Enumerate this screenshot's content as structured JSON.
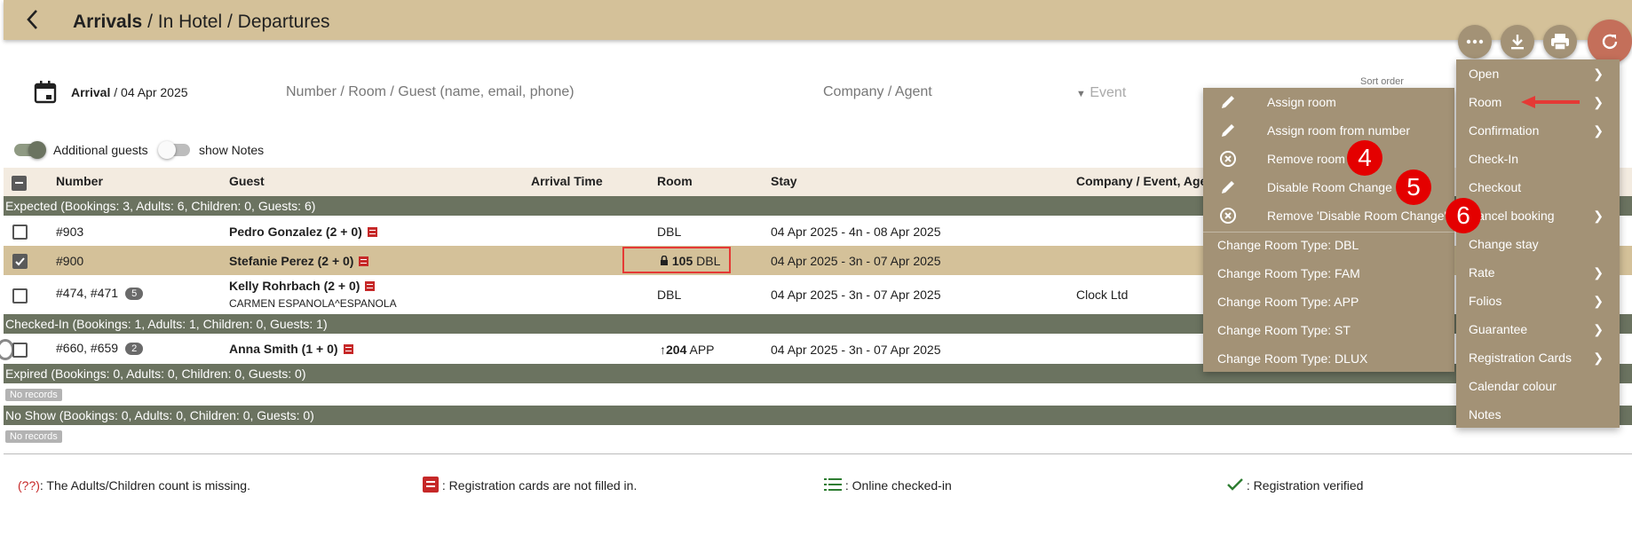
{
  "header": {
    "back_icon": "chevron-left-icon",
    "crumbs": [
      "Arrivals",
      "In Hotel",
      "Departures"
    ],
    "separator": "/"
  },
  "toolbar": {
    "more_icon": "more-horizontal-icon",
    "download_icon": "download-icon",
    "print_icon": "print-icon",
    "refresh_icon": "refresh-icon"
  },
  "filters": {
    "arrival_label": "Arrival",
    "arrival_date": "04 Apr 2025",
    "search_placeholder": "Number / Room / Guest (name, email, phone)",
    "company_placeholder": "Company / Agent",
    "event_placeholder": "Event",
    "sort_label": "Sort order"
  },
  "toggles": {
    "additional_guests": "Additional guests",
    "show_notes": "show Notes"
  },
  "table": {
    "headers": [
      "Number",
      "Guest",
      "Arrival Time",
      "Room",
      "Stay",
      "Company / Event, Agen"
    ],
    "groups": {
      "expected": "Expected (Bookings: 3, Adults: 6, Children: 0, Guests: 6)",
      "checked_in": "Checked-In (Bookings: 1, Adults: 1, Children: 0, Guests: 1)",
      "expired": "Expired (Bookings: 0, Adults: 0, Children: 0, Guests: 0)",
      "no_show": "No Show (Bookings: 0, Adults: 0, Children: 0, Guests: 0)"
    },
    "no_records": "No records",
    "rows": [
      {
        "number": "#903",
        "guest": "Pedro Gonzalez (2 + 0)",
        "room_type": "DBL",
        "stay": "04 Apr 2025 - 4n - 08 Apr 2025"
      },
      {
        "number": "#900",
        "guest": "Stefanie Perez (2 + 0)",
        "room_num": "105",
        "room_type": "DBL",
        "stay": "04 Apr 2025 - 3n - 07 Apr 2025"
      },
      {
        "number": "#474, #471",
        "badge": "5",
        "guest": "Kelly Rohrbach (2 + 0)",
        "sub": "CARMEN ESPANOLA^ESPANOLA",
        "room_type": "DBL",
        "stay": "04 Apr 2025 - 3n - 07 Apr 2025",
        "company": "Clock Ltd"
      },
      {
        "number": "#660, #659",
        "badge": "2",
        "guest": "Anna Smith (1 + 0)",
        "room_num": "204",
        "room_type": "APP",
        "stay": "04 Apr 2025 - 3n - 07 Apr 2025"
      }
    ]
  },
  "legend": {
    "missing_marker": "(??)",
    "missing": ": The Adults/Children count is missing.",
    "regcard": ": Registration cards are not filled in.",
    "online": ": Online checked-in",
    "verified": ": Registration verified"
  },
  "room_submenu": {
    "items": [
      "Assign room",
      "Assign room from number",
      "Remove room",
      "Disable Room Change",
      "Remove 'Disable Room Change'"
    ],
    "change_types": [
      "Change Room Type: DBL",
      "Change Room Type: FAM",
      "Change Room Type: APP",
      "Change Room Type: ST",
      "Change Room Type: DLUX"
    ]
  },
  "context_menu": {
    "items": [
      "Open",
      "Room",
      "Confirmation",
      "Check-In",
      "Checkout",
      "Cancel booking",
      "Change stay",
      "Rate",
      "Folios",
      "Guarantee",
      "Registration Cards",
      "Calendar colour",
      "Notes"
    ]
  },
  "steps": [
    "4",
    "5",
    "6"
  ],
  "colors": {
    "header_bg": "#d4c199",
    "group_bg": "#6b7360",
    "menu_bg": "#a39276",
    "selected_row": "#d4c199",
    "step_red": "#e40000",
    "highlight_red": "#e53935"
  }
}
